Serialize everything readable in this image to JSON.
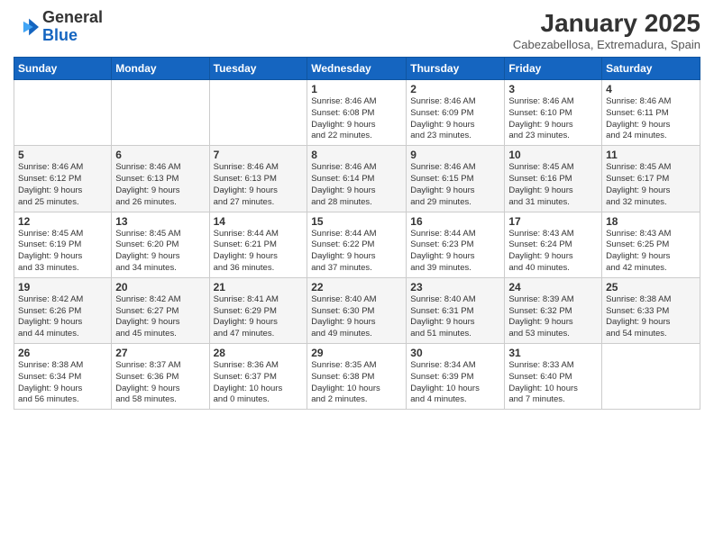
{
  "logo": {
    "line1": "General",
    "line2": "Blue"
  },
  "title": "January 2025",
  "subtitle": "Cabezabellosa, Extremadura, Spain",
  "days_header": [
    "Sunday",
    "Monday",
    "Tuesday",
    "Wednesday",
    "Thursday",
    "Friday",
    "Saturday"
  ],
  "weeks": [
    [
      {
        "day": "",
        "info": ""
      },
      {
        "day": "",
        "info": ""
      },
      {
        "day": "",
        "info": ""
      },
      {
        "day": "1",
        "info": "Sunrise: 8:46 AM\nSunset: 6:08 PM\nDaylight: 9 hours\nand 22 minutes."
      },
      {
        "day": "2",
        "info": "Sunrise: 8:46 AM\nSunset: 6:09 PM\nDaylight: 9 hours\nand 23 minutes."
      },
      {
        "day": "3",
        "info": "Sunrise: 8:46 AM\nSunset: 6:10 PM\nDaylight: 9 hours\nand 23 minutes."
      },
      {
        "day": "4",
        "info": "Sunrise: 8:46 AM\nSunset: 6:11 PM\nDaylight: 9 hours\nand 24 minutes."
      }
    ],
    [
      {
        "day": "5",
        "info": "Sunrise: 8:46 AM\nSunset: 6:12 PM\nDaylight: 9 hours\nand 25 minutes."
      },
      {
        "day": "6",
        "info": "Sunrise: 8:46 AM\nSunset: 6:13 PM\nDaylight: 9 hours\nand 26 minutes."
      },
      {
        "day": "7",
        "info": "Sunrise: 8:46 AM\nSunset: 6:13 PM\nDaylight: 9 hours\nand 27 minutes."
      },
      {
        "day": "8",
        "info": "Sunrise: 8:46 AM\nSunset: 6:14 PM\nDaylight: 9 hours\nand 28 minutes."
      },
      {
        "day": "9",
        "info": "Sunrise: 8:46 AM\nSunset: 6:15 PM\nDaylight: 9 hours\nand 29 minutes."
      },
      {
        "day": "10",
        "info": "Sunrise: 8:45 AM\nSunset: 6:16 PM\nDaylight: 9 hours\nand 31 minutes."
      },
      {
        "day": "11",
        "info": "Sunrise: 8:45 AM\nSunset: 6:17 PM\nDaylight: 9 hours\nand 32 minutes."
      }
    ],
    [
      {
        "day": "12",
        "info": "Sunrise: 8:45 AM\nSunset: 6:19 PM\nDaylight: 9 hours\nand 33 minutes."
      },
      {
        "day": "13",
        "info": "Sunrise: 8:45 AM\nSunset: 6:20 PM\nDaylight: 9 hours\nand 34 minutes."
      },
      {
        "day": "14",
        "info": "Sunrise: 8:44 AM\nSunset: 6:21 PM\nDaylight: 9 hours\nand 36 minutes."
      },
      {
        "day": "15",
        "info": "Sunrise: 8:44 AM\nSunset: 6:22 PM\nDaylight: 9 hours\nand 37 minutes."
      },
      {
        "day": "16",
        "info": "Sunrise: 8:44 AM\nSunset: 6:23 PM\nDaylight: 9 hours\nand 39 minutes."
      },
      {
        "day": "17",
        "info": "Sunrise: 8:43 AM\nSunset: 6:24 PM\nDaylight: 9 hours\nand 40 minutes."
      },
      {
        "day": "18",
        "info": "Sunrise: 8:43 AM\nSunset: 6:25 PM\nDaylight: 9 hours\nand 42 minutes."
      }
    ],
    [
      {
        "day": "19",
        "info": "Sunrise: 8:42 AM\nSunset: 6:26 PM\nDaylight: 9 hours\nand 44 minutes."
      },
      {
        "day": "20",
        "info": "Sunrise: 8:42 AM\nSunset: 6:27 PM\nDaylight: 9 hours\nand 45 minutes."
      },
      {
        "day": "21",
        "info": "Sunrise: 8:41 AM\nSunset: 6:29 PM\nDaylight: 9 hours\nand 47 minutes."
      },
      {
        "day": "22",
        "info": "Sunrise: 8:40 AM\nSunset: 6:30 PM\nDaylight: 9 hours\nand 49 minutes."
      },
      {
        "day": "23",
        "info": "Sunrise: 8:40 AM\nSunset: 6:31 PM\nDaylight: 9 hours\nand 51 minutes."
      },
      {
        "day": "24",
        "info": "Sunrise: 8:39 AM\nSunset: 6:32 PM\nDaylight: 9 hours\nand 53 minutes."
      },
      {
        "day": "25",
        "info": "Sunrise: 8:38 AM\nSunset: 6:33 PM\nDaylight: 9 hours\nand 54 minutes."
      }
    ],
    [
      {
        "day": "26",
        "info": "Sunrise: 8:38 AM\nSunset: 6:34 PM\nDaylight: 9 hours\nand 56 minutes."
      },
      {
        "day": "27",
        "info": "Sunrise: 8:37 AM\nSunset: 6:36 PM\nDaylight: 9 hours\nand 58 minutes."
      },
      {
        "day": "28",
        "info": "Sunrise: 8:36 AM\nSunset: 6:37 PM\nDaylight: 10 hours\nand 0 minutes."
      },
      {
        "day": "29",
        "info": "Sunrise: 8:35 AM\nSunset: 6:38 PM\nDaylight: 10 hours\nand 2 minutes."
      },
      {
        "day": "30",
        "info": "Sunrise: 8:34 AM\nSunset: 6:39 PM\nDaylight: 10 hours\nand 4 minutes."
      },
      {
        "day": "31",
        "info": "Sunrise: 8:33 AM\nSunset: 6:40 PM\nDaylight: 10 hours\nand 7 minutes."
      },
      {
        "day": "",
        "info": ""
      }
    ]
  ]
}
